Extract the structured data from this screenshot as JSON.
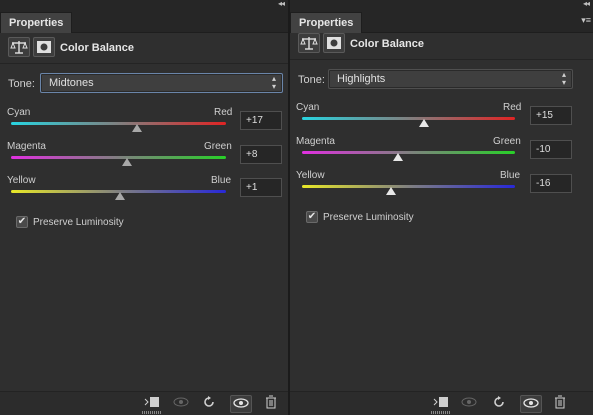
{
  "panels": [
    {
      "tab_label": "Properties",
      "collapse_glyph": "◂◂",
      "menu_glyph": "",
      "title": "Color Balance",
      "tone_label": "Tone:",
      "tone_value": "Midtones",
      "sliders": [
        {
          "left": "Cyan",
          "right": "Red",
          "value": "+17",
          "min": -100,
          "max": 100,
          "level": 17
        },
        {
          "left": "Magenta",
          "right": "Green",
          "value": "+8",
          "min": -100,
          "max": 100,
          "level": 8
        },
        {
          "left": "Yellow",
          "right": "Blue",
          "value": "+1",
          "min": -100,
          "max": 100,
          "level": 1
        }
      ],
      "preserve_label": "Preserve Luminosity",
      "preserve_checked": true,
      "footer": [
        "clip-to-layer-icon",
        "view-previous-state-icon",
        "reset-icon",
        "visibility-eye-icon",
        "trash-icon"
      ]
    },
    {
      "tab_label": "Properties",
      "collapse_glyph": "◂◂",
      "menu_glyph": "▾≡",
      "title": "Color Balance",
      "tone_label": "Tone:",
      "tone_value": "Highlights",
      "sliders": [
        {
          "left": "Cyan",
          "right": "Red",
          "value": "+15",
          "min": -100,
          "max": 100,
          "level": 15
        },
        {
          "left": "Magenta",
          "right": "Green",
          "value": "-10",
          "min": -100,
          "max": 100,
          "level": -10
        },
        {
          "left": "Yellow",
          "right": "Blue",
          "value": "-16",
          "min": -100,
          "max": 100,
          "level": -16
        }
      ],
      "preserve_label": "Preserve Luminosity",
      "preserve_checked": true,
      "footer": [
        "clip-to-layer-icon",
        "view-previous-state-icon",
        "reset-icon",
        "visibility-eye-icon",
        "trash-icon"
      ]
    }
  ],
  "colors": {
    "cyan": "#28d4e0",
    "red": "#e02424",
    "magenta": "#e030e0",
    "green": "#28d028",
    "yellow": "#e8e828",
    "blue": "#2828d8",
    "tone_border": "#6a85a9",
    "panel_bg": "#2f2f2f"
  },
  "check_glyph": "✔"
}
